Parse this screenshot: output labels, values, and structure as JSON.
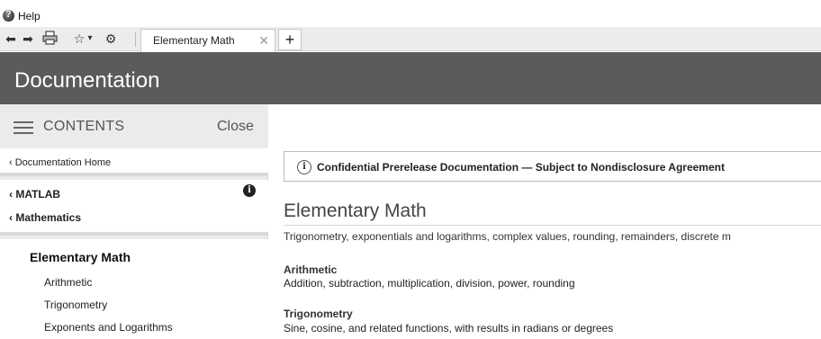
{
  "window": {
    "title": "Help",
    "icon": "help-icon"
  },
  "toolbar": {
    "back_icon": "⬅",
    "forward_icon": "➡",
    "print_icon": "🖨",
    "favorites_icon": "☆",
    "favorites_dropdown": "▾",
    "settings_icon": "⚙",
    "tab_label": "Elementary Math",
    "tab_close": "✕",
    "new_tab_label": "+"
  },
  "header": {
    "title": "Documentation",
    "background": "#5b5b5b"
  },
  "sidebar": {
    "contents_label": "CONTENTS",
    "close_label": "Close",
    "home_link": "‹ Documentation Home",
    "breadcrumbs": [
      "‹ MATLAB",
      "‹ Mathematics"
    ],
    "info_icon": "i",
    "toc_heading": "Elementary Math",
    "toc_items": [
      "Arithmetic",
      "Trigonometry",
      "Exponents and Logarithms"
    ]
  },
  "main": {
    "notice": "Confidential Prerelease Documentation — Subject to Nondisclosure Agreement",
    "notice_icon": "i",
    "title": "Elementary Math",
    "summary": "Trigonometry, exponentials and logarithms, complex values, rounding, remainders, discrete m",
    "sections": [
      {
        "heading": "Arithmetic",
        "description": "Addition, subtraction, multiplication, division, power, rounding"
      },
      {
        "heading": "Trigonometry",
        "description": "Sine, cosine, and related functions, with results in radians or degrees"
      }
    ]
  }
}
